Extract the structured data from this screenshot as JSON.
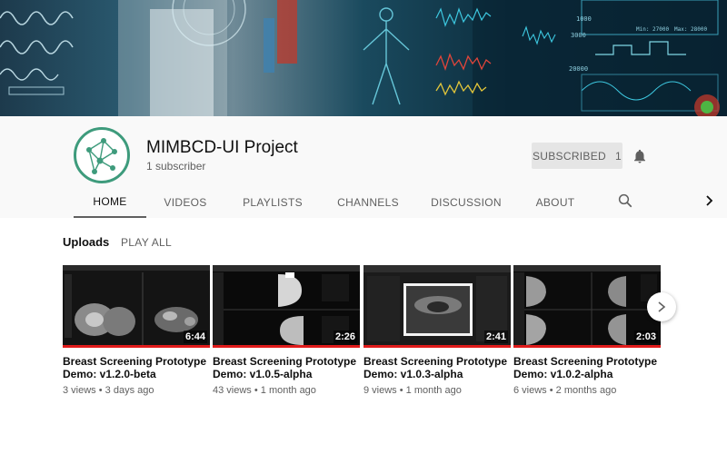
{
  "channel": {
    "name": "MIMBCD-UI Project",
    "subscribers": "1 subscriber",
    "subscribe_label": "SUBSCRIBED",
    "subscribe_count": "1"
  },
  "tabs": [
    "HOME",
    "VIDEOS",
    "PLAYLISTS",
    "CHANNELS",
    "DISCUSSION",
    "ABOUT"
  ],
  "active_tab": "HOME",
  "shelf": {
    "title": "Uploads",
    "play_all": "PLAY ALL"
  },
  "videos": [
    {
      "title_line1": "Breast Screening Prototype",
      "title_line2": "Demo: v1.2.0-beta",
      "duration": "6:44",
      "views": "3 views",
      "age": "3 days ago",
      "watched_fraction": 1.0
    },
    {
      "title_line1": "Breast Screening Prototype",
      "title_line2": "Demo: v1.0.5-alpha",
      "duration": "2:26",
      "views": "43 views",
      "age": "1 month ago",
      "watched_fraction": 1.0
    },
    {
      "title_line1": "Breast Screening Prototype",
      "title_line2": "Demo: v1.0.3-alpha",
      "duration": "2:41",
      "views": "9 views",
      "age": "1 month ago",
      "watched_fraction": 1.0
    },
    {
      "title_line1": "Breast Screening Prototype",
      "title_line2": "Demo: v1.0.2-alpha",
      "duration": "2:03",
      "views": "6 views",
      "age": "2 months ago",
      "watched_fraction": 1.0
    }
  ],
  "banner_readouts": [
    "1000",
    "3000",
    "20000",
    "Min: 27000",
    "Max: 28000"
  ],
  "colors": {
    "accent": "#3e9b7c",
    "progress": "#e01b1b",
    "header_bg": "#f9f9f9"
  },
  "icons": {
    "bell": "bell-icon",
    "search": "search-icon",
    "next": "chevron-right-icon"
  }
}
